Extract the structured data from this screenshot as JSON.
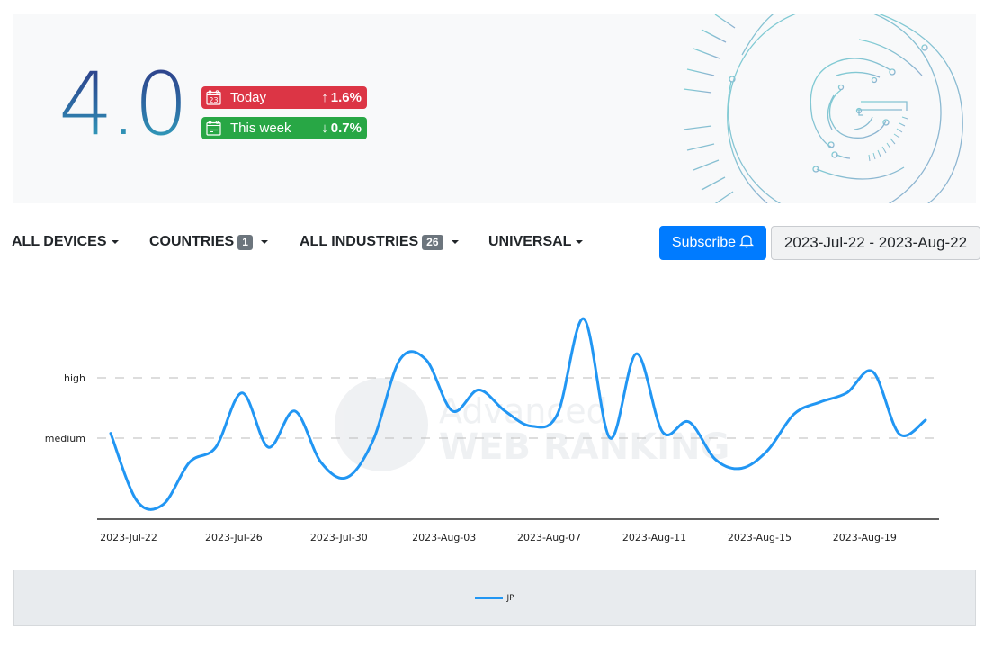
{
  "hero": {
    "score": "4.0",
    "badges": [
      {
        "icon": "calendar-day-icon",
        "icon_text": "23",
        "label": "Today",
        "direction": "up",
        "arrow": "↑",
        "change": "1.6%",
        "color": "#dc3545"
      },
      {
        "icon": "calendar-week-icon",
        "icon_text": "",
        "label": "This week",
        "direction": "down",
        "arrow": "↓",
        "change": "0.7%",
        "color": "#28a745"
      }
    ],
    "logo": "google-circuit-logo"
  },
  "filters": {
    "devices": {
      "label": "ALL DEVICES"
    },
    "countries": {
      "label": "COUNTRIES",
      "count": "1"
    },
    "industries": {
      "label": "ALL INDUSTRIES",
      "count": "26"
    },
    "search_type": {
      "label": "UNIVERSAL"
    },
    "subscribe_label": "Subscribe",
    "date_range": "2023-Jul-22 - 2023-Aug-22"
  },
  "watermark": {
    "line1": "Advanced",
    "line2": "WEB RANKING"
  },
  "chart_data": {
    "type": "line",
    "title": "",
    "xlabel": "",
    "ylabel": "",
    "y_levels": [
      {
        "label": "high",
        "value": 2
      },
      {
        "label": "medium",
        "value": 1
      }
    ],
    "ylim": [
      -0.35,
      2.55
    ],
    "grid": "dashed horizontal at level ticks",
    "x_tick_labels": [
      "2023-Jul-22",
      "2023-Jul-26",
      "2023-Jul-30",
      "2023-Aug-03",
      "2023-Aug-07",
      "2023-Aug-11",
      "2023-Aug-15",
      "2023-Aug-19"
    ],
    "x_tick_every_n_days": 4,
    "x": [
      "2023-Jul-22",
      "2023-Jul-23",
      "2023-Jul-24",
      "2023-Jul-25",
      "2023-Jul-26",
      "2023-Jul-27",
      "2023-Jul-28",
      "2023-Jul-29",
      "2023-Jul-30",
      "2023-Jul-31",
      "2023-Aug-01",
      "2023-Aug-02",
      "2023-Aug-03",
      "2023-Aug-04",
      "2023-Aug-05",
      "2023-Aug-06",
      "2023-Aug-07",
      "2023-Aug-08",
      "2023-Aug-09",
      "2023-Aug-10",
      "2023-Aug-11",
      "2023-Aug-12",
      "2023-Aug-13",
      "2023-Aug-14",
      "2023-Aug-15",
      "2023-Aug-16",
      "2023-Aug-17",
      "2023-Aug-18",
      "2023-Aug-19",
      "2023-Aug-20",
      "2023-Aug-21",
      "2023-Aug-22"
    ],
    "series": [
      {
        "name": "JP",
        "color": "#2196f3",
        "values": [
          1.08,
          -0.04,
          -0.1,
          0.6,
          0.85,
          1.75,
          0.85,
          1.45,
          0.6,
          0.35,
          0.98,
          2.3,
          2.3,
          1.45,
          1.8,
          1.45,
          1.2,
          1.4,
          2.98,
          1.0,
          2.4,
          1.1,
          1.27,
          0.65,
          0.5,
          0.8,
          1.4,
          1.6,
          1.75,
          2.1,
          1.07,
          1.3
        ]
      }
    ],
    "legend": {
      "position": "bottom-center",
      "entries": [
        "JP"
      ]
    }
  }
}
